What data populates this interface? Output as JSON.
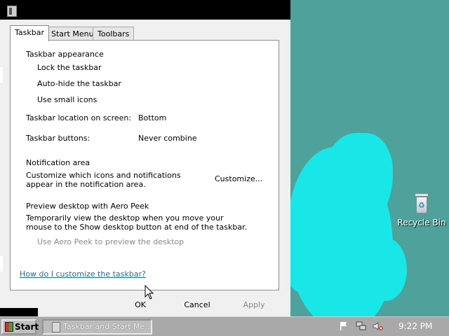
{
  "dialog": {
    "tabs": [
      {
        "label": "Taskbar",
        "active": true
      },
      {
        "label": "Start Menu",
        "active": false
      },
      {
        "label": "Toolbars",
        "active": false
      }
    ],
    "sections": {
      "appearance_heading": "Taskbar appearance",
      "lock_taskbar": "Lock the taskbar",
      "auto_hide": "Auto-hide the taskbar",
      "small_icons": "Use small icons",
      "location_label": "Taskbar location on screen:",
      "location_value": "Bottom",
      "buttons_label": "Taskbar buttons:",
      "buttons_value": "Never combine",
      "notification_heading": "Notification area",
      "notification_desc": "Customize which icons and notifications appear in the notification area.",
      "customize_button": "Customize...",
      "peek_heading": "Preview desktop with Aero Peek",
      "peek_desc": "Temporarily view the desktop when you move your mouse to the Show desktop button at end of the taskbar.",
      "peek_checkbox": "Use Aero Peek to preview the desktop",
      "help_link": "How do I customize the taskbar?"
    },
    "buttons": {
      "ok": "OK",
      "cancel": "Cancel",
      "apply": "Apply"
    }
  },
  "desktop": {
    "recycle_bin_label": "Recycle Bin"
  },
  "taskbar": {
    "start_label": "Start",
    "task_label": "Taskbar and Start Me...",
    "clock": "9:22 PM",
    "tray_icons": [
      "flag-icon",
      "network-icon",
      "volume-muted-icon"
    ]
  },
  "colors": {
    "desktop": "#4fa19b",
    "splash": "#19e6e6",
    "link": "#1a6fb0",
    "taskbar": "#a9a9a9"
  }
}
